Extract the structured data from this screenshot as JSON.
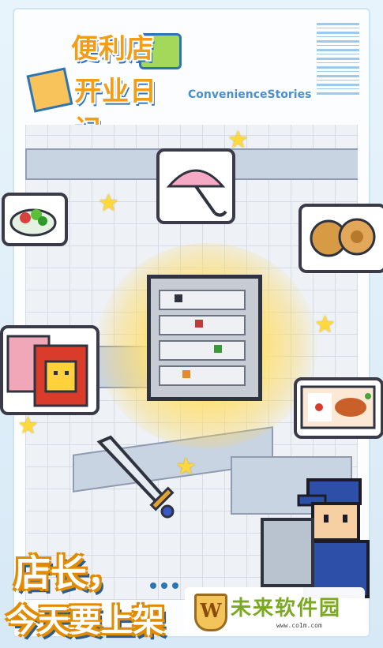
{
  "logo": {
    "title_line1": "便利店",
    "title_line2": "开业日记",
    "subtitle": "ConvenienceStories"
  },
  "banner": {
    "line1": "店长，",
    "line2": "今天要上架"
  },
  "watermark": {
    "emblem_letter": "W",
    "text": "未来软件园",
    "url": "www.co1m.com"
  },
  "icons": {
    "items": [
      "salad-icon",
      "umbrella-icon",
      "bread-icon",
      "display-cabinet-icon",
      "gift-box-icon",
      "bento-icon",
      "sword-icon"
    ]
  },
  "colors": {
    "title_orange": "#f39c17",
    "outline_blue": "#2c74b8",
    "star_yellow": "#ffd93b"
  }
}
